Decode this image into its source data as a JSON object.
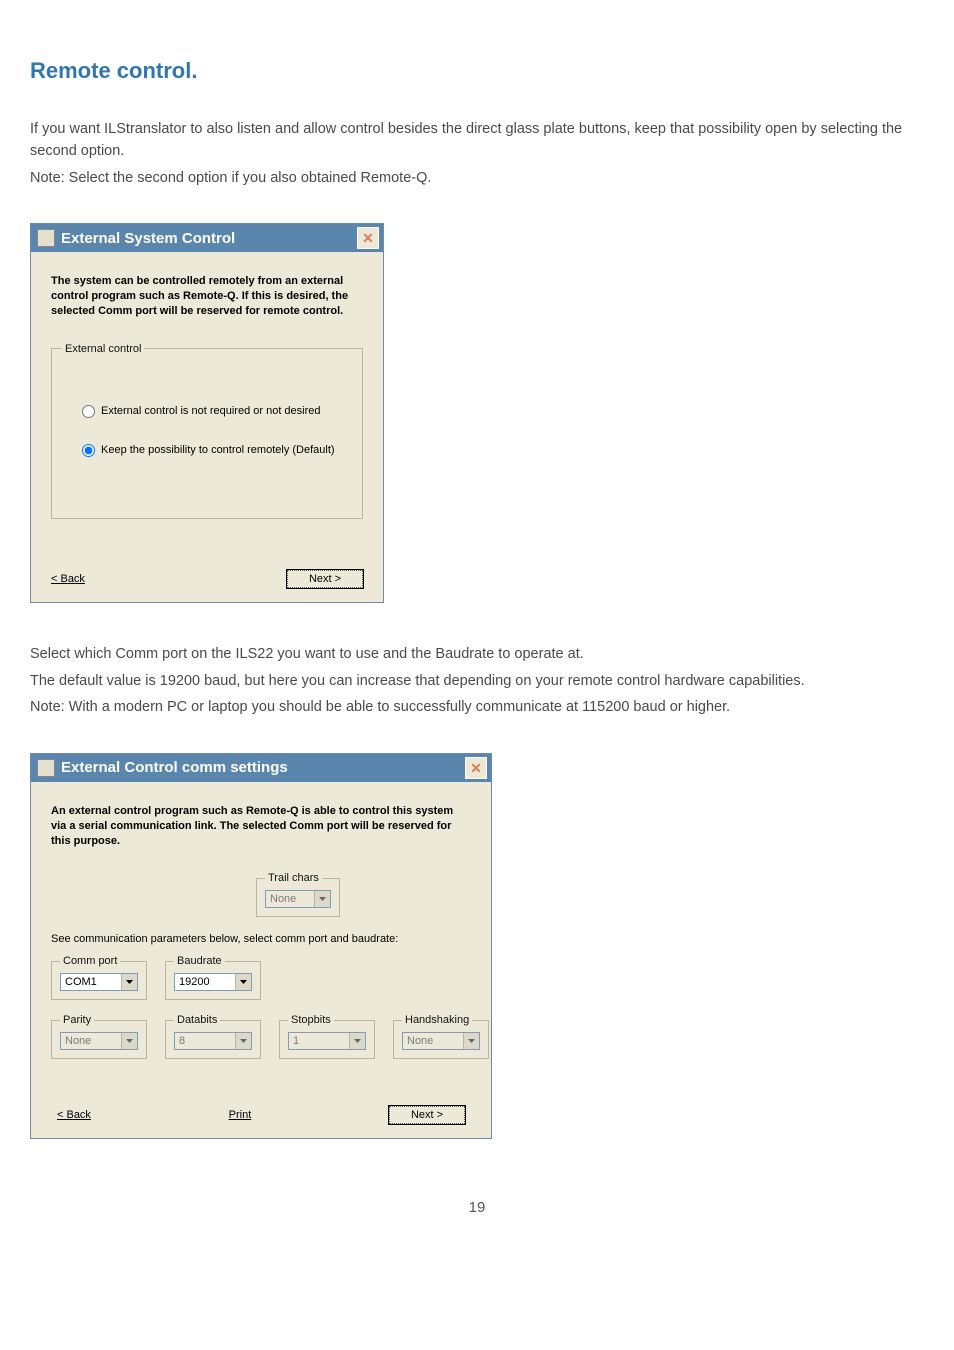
{
  "section_title": "Remote control.",
  "para1_a": "If you want ILStranslator to also listen and allow control besides the direct glass plate buttons, keep that possibility open by selecting the second option.",
  "para1_b": "Note: Select the second option if you also obtained Remote-Q.",
  "dialog1": {
    "title": "External System Control",
    "desc": "The system can be controlled remotely from an external control program such as Remote-Q. If this is desired, the selected Comm port will be reserved for remote control.",
    "group_legend": "External control",
    "radio1": "External control is not required or not desired",
    "radio2": "Keep the possibility to control remotely  (Default)",
    "back": "< Back",
    "next": "Next >"
  },
  "para2_a": "Select which Comm port on the ILS22 you want to use and the Baudrate to operate at.",
  "para2_b": "The default value is 19200 baud, but here you can increase that depending on your remote control hardware capabilities.",
  "para2_c": "Note: With a modern PC or laptop you should be able to successfully communicate at 115200 baud or higher.",
  "dialog2": {
    "title": "External Control comm settings",
    "desc": "An external control program such as Remote-Q is able to control this system via a serial communication link. The selected Comm port will be reserved for this purpose.",
    "trail_legend": "Trail chars",
    "trail_value": "None",
    "instr": "See communication parameters below, select comm port and baudrate:",
    "commport_legend": "Comm port",
    "commport_value": "COM1",
    "baud_legend": "Baudrate",
    "baud_value": "19200",
    "parity_legend": "Parity",
    "parity_value": "None",
    "databits_legend": "Databits",
    "databits_value": "8",
    "stopbits_legend": "Stopbits",
    "stopbits_value": "1",
    "handshaking_legend": "Handshaking",
    "handshaking_value": "None",
    "back": "< Back",
    "print": "Print",
    "next": "Next >"
  },
  "page_number": "19"
}
